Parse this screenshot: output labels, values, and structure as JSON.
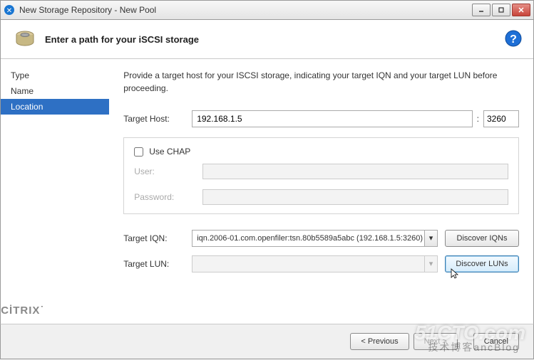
{
  "titlebar": {
    "title": "New Storage Repository - New Pool"
  },
  "header": {
    "title": "Enter a path for your iSCSI storage"
  },
  "sidebar": {
    "items": [
      {
        "label": "Type",
        "selected": false
      },
      {
        "label": "Name",
        "selected": false
      },
      {
        "label": "Location",
        "selected": true
      }
    ]
  },
  "content": {
    "instruction": "Provide a target host for your ISCSI storage, indicating your target IQN and your target LUN before proceeding.",
    "target_host_label": "Target Host:",
    "target_host_value": "192.168.1.5",
    "port_separator": ":",
    "port_value": "3260",
    "chap": {
      "label": "Use CHAP",
      "checked": false,
      "user_label": "User:",
      "user_value": "",
      "password_label": "Password:",
      "password_value": ""
    },
    "iqn": {
      "label": "Target IQN:",
      "value": "iqn.2006-01.com.openfiler:tsn.80b5589a5abc (192.168.1.5:3260)",
      "button": "Discover IQNs"
    },
    "lun": {
      "label": "Target LUN:",
      "value": "",
      "button": "Discover LUNs"
    }
  },
  "branding": "CİTRIX",
  "footer": {
    "previous": "< Previous",
    "next": "Next >",
    "cancel": "Cancel"
  },
  "watermark": {
    "main": "51CTO.com",
    "sub": "技术博客ancBlog"
  }
}
